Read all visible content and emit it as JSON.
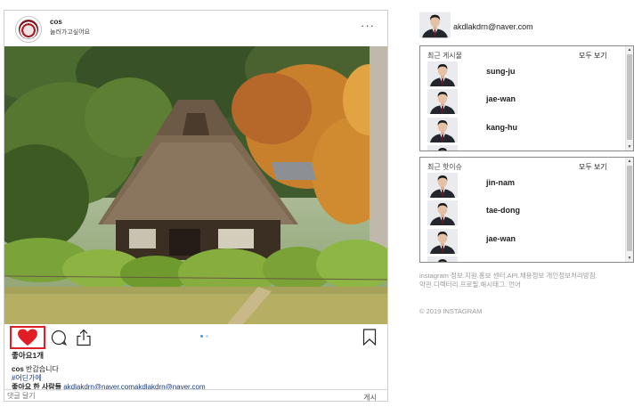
{
  "post": {
    "username": "cos",
    "location": "놀러가고싶어요",
    "more_icon": "more-dots-icon",
    "photo_icon": "post-photo",
    "likes_text": "좋아요1개",
    "caption_user": "cos",
    "caption_text": " 반갑습니다",
    "hashtag": "#어딘가에",
    "liked_by_prefix": "좋아요 한 사람들 ",
    "liked_by_names": "akdlakdrn@naver.comakdlakdrn@naver.com",
    "comment_placeholder": "댓글 달기",
    "post_button": "게시",
    "carousel_pages": 2,
    "carousel_active": 1,
    "accent_like": "#e01e26",
    "accent_dot": "#3897f0"
  },
  "sidebar": {
    "me": "akdlakdrn@naver.com",
    "recent": {
      "title": "최근 게시물",
      "see_all": "모두 보기",
      "items": [
        {
          "name": "sung-ju"
        },
        {
          "name": "jae-wan"
        },
        {
          "name": "kang-hu"
        }
      ]
    },
    "stories": {
      "title": "최근 핫이슈",
      "see_all": "모두 보기",
      "items": [
        {
          "name": "jin-nam"
        },
        {
          "name": "tae-dong"
        },
        {
          "name": "jae-wan"
        }
      ]
    },
    "footer_links": "instagram 정보.지원.홍보 센터.API.채용정보 개인정보처리방침.약관.디렉터리.프로필.해시태그. 언어",
    "copyright": "© 2019 INSTAGRAM"
  }
}
